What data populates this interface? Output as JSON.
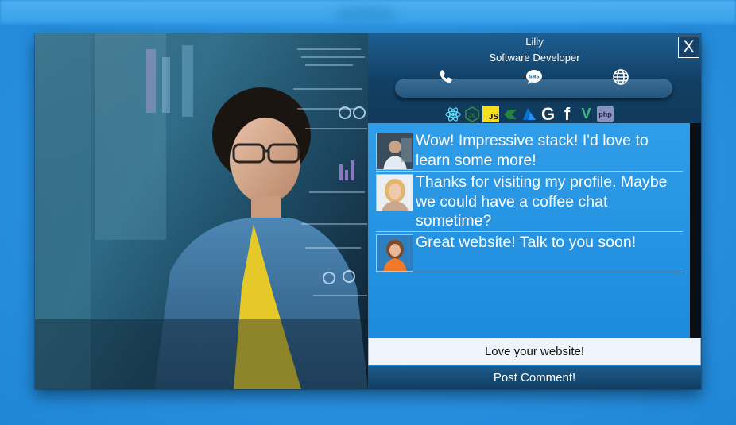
{
  "profile": {
    "name": "Lilly",
    "title": "Software Developer"
  },
  "close_label": "X",
  "contact": {
    "icons": [
      "phone-icon",
      "sms-icon",
      "globe-icon"
    ],
    "sms_label": "SMS"
  },
  "tech_stack": [
    {
      "name": "react-icon",
      "color": "#61dafb"
    },
    {
      "name": "nodejs-icon",
      "color": "#3c873a",
      "label": "JS"
    },
    {
      "name": "javascript-icon",
      "color": "#f7df1e",
      "label": "JS"
    },
    {
      "name": "csharp-icon",
      "color": "#2a8f3c"
    },
    {
      "name": "azure-icon",
      "color": "#0078d4"
    },
    {
      "name": "google-icon",
      "color": "#ffffff",
      "label": "G"
    },
    {
      "name": "facebook-icon",
      "color": "#ffffff",
      "label": "f"
    },
    {
      "name": "vue-icon",
      "color": "#41b883",
      "label": "V"
    },
    {
      "name": "php-icon",
      "color": "#8892bf",
      "label": "php"
    }
  ],
  "comments": [
    {
      "text": "Wow! Impressive stack! I'd love to learn some more!"
    },
    {
      "text": "Thanks for visiting my profile. Maybe we could have a coffee chat sometime?"
    },
    {
      "text": "Great website! Talk to you soon!"
    }
  ],
  "comment_input": {
    "value": "Love your website!"
  },
  "post_button_label": "Post Comment!",
  "colors": {
    "accent": "#1a87d6",
    "header_dark": "#123f63",
    "background": "#2b93e2"
  }
}
